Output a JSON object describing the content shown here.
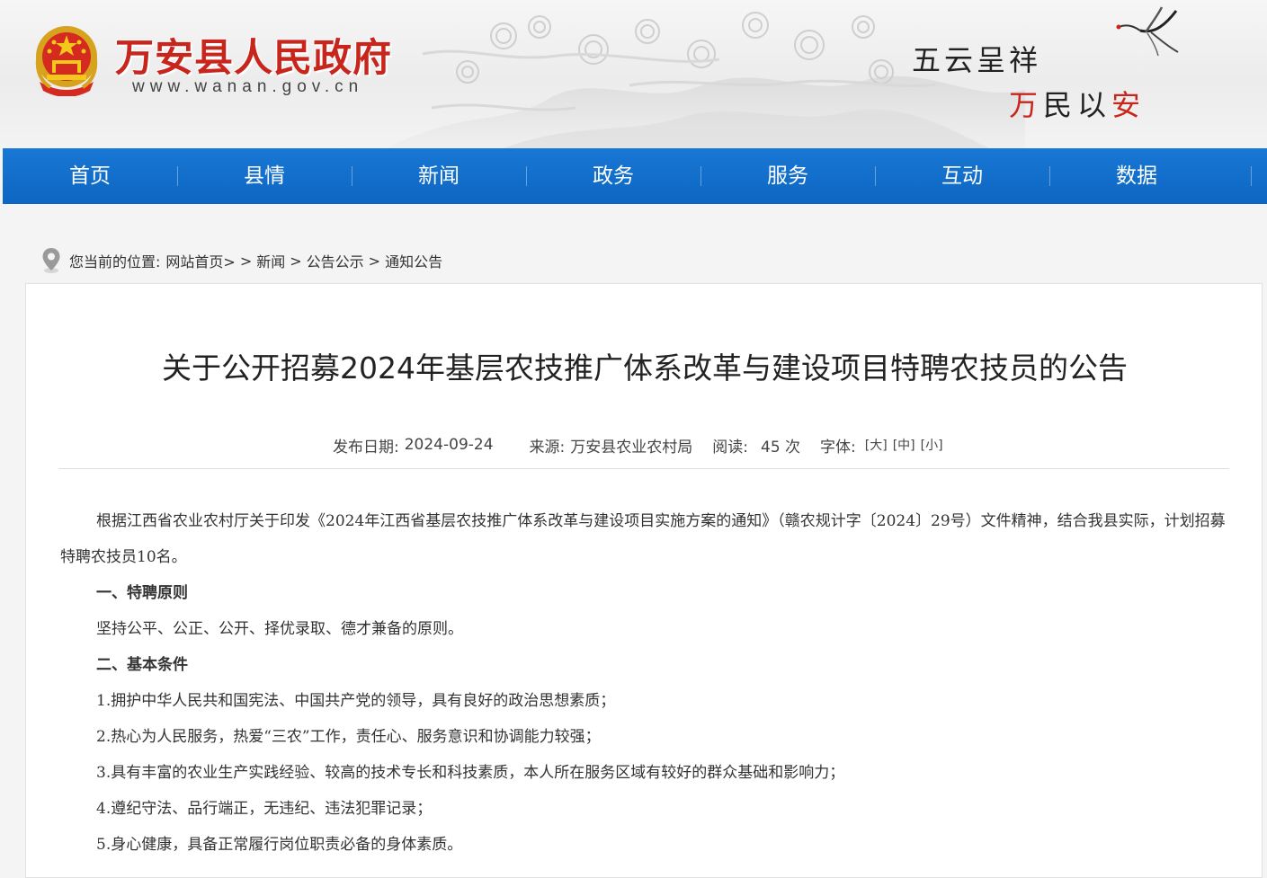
{
  "header": {
    "site_title": "万安县人民政府",
    "site_url": "www.wanan.gov.cn",
    "slogan_line1": "五云呈祥",
    "slogan_line2_first": "万",
    "slogan_line2_mid": "民以",
    "slogan_line2_last": "安"
  },
  "nav": {
    "items": [
      "首页",
      "县情",
      "新闻",
      "政务",
      "服务",
      "互动",
      "数据"
    ]
  },
  "breadcrumb": {
    "prefix": "您当前的位置:",
    "items": [
      "网站首页>",
      "新闻",
      "公告公示",
      "通知公告"
    ],
    "separator": ">"
  },
  "article": {
    "title": "关于公开招募2024年基层农技推广体系改革与建设项目特聘农技员的公告",
    "meta": {
      "date_label": "发布日期:",
      "date": "2024-09-24",
      "source_label": "来源:",
      "source": "万安县农业农村局",
      "reads_label": "阅读:",
      "reads": "45 次",
      "font_label": "字体:",
      "font_large": "[大]",
      "font_medium": "[中]",
      "font_small": "[小]"
    },
    "paragraphs": {
      "intro": "根据江西省农业农村厅关于印发《2024年江西省基层农技推广体系改革与建设项目实施方案的通知》（赣农规计字〔2024〕29号）文件精神，结合我县实际，计划招募特聘农技员10名。",
      "h1": "一、特聘原则",
      "p1": "坚持公平、公正、公开、择优录取、德才兼备的原则。",
      "h2": "二、基本条件",
      "c1": "1.拥护中华人民共和国宪法、中国共产党的领导，具有良好的政治思想素质；",
      "c2": "2.热心为人民服务，热爱“三农”工作，责任心、服务意识和协调能力较强；",
      "c3": "3.具有丰富的农业生产实践经验、较高的技术专长和科技素质，本人所在服务区域有较好的群众基础和影响力；",
      "c4": "4.遵纪守法、品行端正，无违纪、违法犯罪记录；",
      "c5": "5.身心健康，具备正常履行岗位职责必备的身体素质。"
    }
  },
  "colors": {
    "brand_red": "#c8261c",
    "nav_blue": "#0d66c2"
  },
  "icons": {
    "emblem": "national-emblem-icon",
    "crane": "crane-icon",
    "location": "location-pin-icon"
  }
}
